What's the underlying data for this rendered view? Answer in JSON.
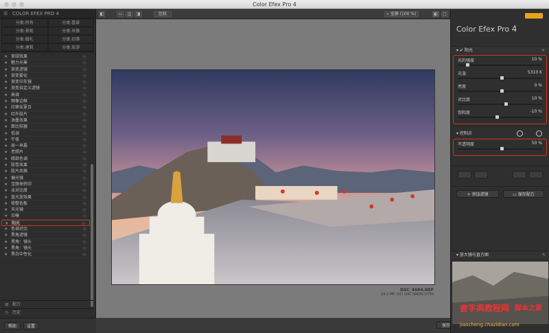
{
  "window": {
    "title": "Color Efex Pro 4"
  },
  "left_panel": {
    "brand": "COLOR EFEX PRO 4",
    "categories": [
      "分类:所有",
      "分类:喜爱",
      "分类:景观",
      "分类:肖像",
      "分类:婚礼",
      "分类:旧事",
      "分类:建筑",
      "分类:旅游"
    ],
    "filters": [
      "草绿效果",
      "魅力光晕",
      "渐变滤镜",
      "渐变雾化",
      "渐变中灰镜",
      "渐变自定义滤镜",
      "高调",
      "图像边框",
      "印第安夏日",
      "红外胶片",
      "油墨效果",
      "面比较器",
      "低调",
      "午夜",
      "周一早晨",
      "老照片",
      "暗部色调",
      "胶卷效果",
      "胶片风格",
      "偏光镜",
      "宝丽来转印",
      "淡对比度",
      "蓝光放效果",
      "修整色板",
      "天光镜",
      "日曝",
      "阳光",
      "色调对比",
      "黑角滤镜",
      "黑角：镜头",
      "黑角：镜头",
      "黑白中性化"
    ],
    "selected_filter_index": 26,
    "section_recipe": "配方",
    "section_history": "历史",
    "help_button": "帮助",
    "settings_button": "设置"
  },
  "toolbar": {
    "compare_label": "比较",
    "zoom_label": "全屏 (100 %)"
  },
  "photo": {
    "filename": "DSC_4684.NEF",
    "info": "24.2 MP, ISO 100, NIKON D750"
  },
  "right_panel": {
    "title": "Color Efex Pro",
    "version": "4",
    "filter_name": "阳光",
    "sliders": [
      {
        "label": "光的强度",
        "value": "10 %",
        "pos": 0.1
      },
      {
        "label": "光温",
        "value": "5310 K",
        "pos": 0.5
      },
      {
        "label": "亮度",
        "value": "0 %",
        "pos": 0.5
      },
      {
        "label": "对比度",
        "value": "10 %",
        "pos": 0.55
      },
      {
        "label": "饱和度",
        "value": "-10 %",
        "pos": 0.45
      }
    ],
    "control_points_label": "控制点",
    "opacity": {
      "label": "不透明度",
      "value": "50 %",
      "pos": 0.5
    },
    "add_filter_button": "添加滤镜",
    "save_recipe_button": "保存配方",
    "loupe_label": "放大镜与直方图"
  },
  "bottom": {
    "save_button": "保存"
  },
  "watermark": {
    "text1": "查字典",
    "text2": "教程网",
    "url": "jiaocheng.chazidian.com",
    "site": "脚本之家"
  }
}
